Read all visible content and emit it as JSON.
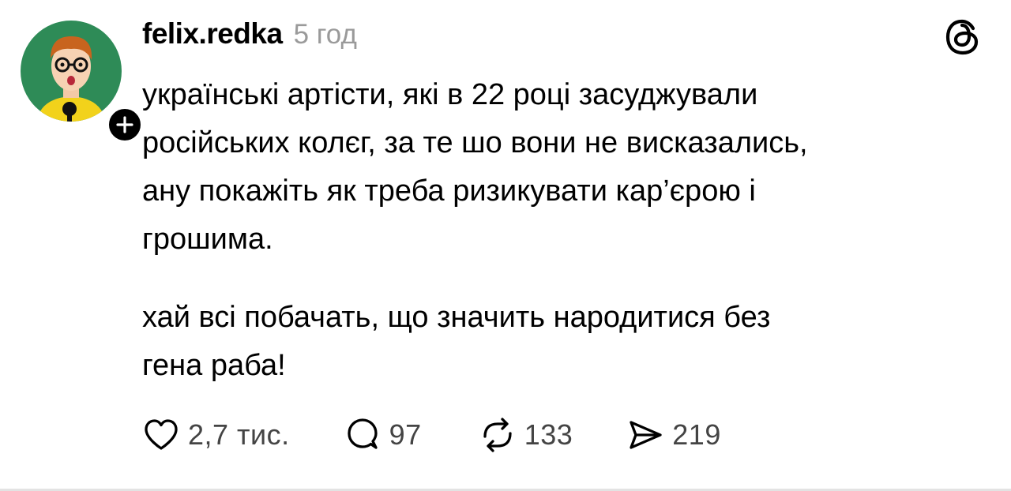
{
  "post": {
    "username": "felix.redka",
    "time": "5 год",
    "paragraphs": [
      "українські артісти, які в 22 році засуджували\nросійських колєг, за те шо вони не висказались,\nану покажіть як треба ризикувати кар’єрою і\nгрошима.",
      "хай всі побачать, що значить народитися без\nгена раба!"
    ]
  },
  "actions": {
    "likes": "2,7 тис.",
    "replies": "97",
    "reposts": "133",
    "shares": "219"
  },
  "icons": [
    "avatar",
    "plus-icon",
    "threads-logo-icon",
    "heart-icon",
    "comment-icon",
    "repost-icon",
    "share-icon"
  ],
  "colors": {
    "avatar_bg": "#2e8b57",
    "text": "#000000",
    "muted": "#9a9a9a"
  }
}
